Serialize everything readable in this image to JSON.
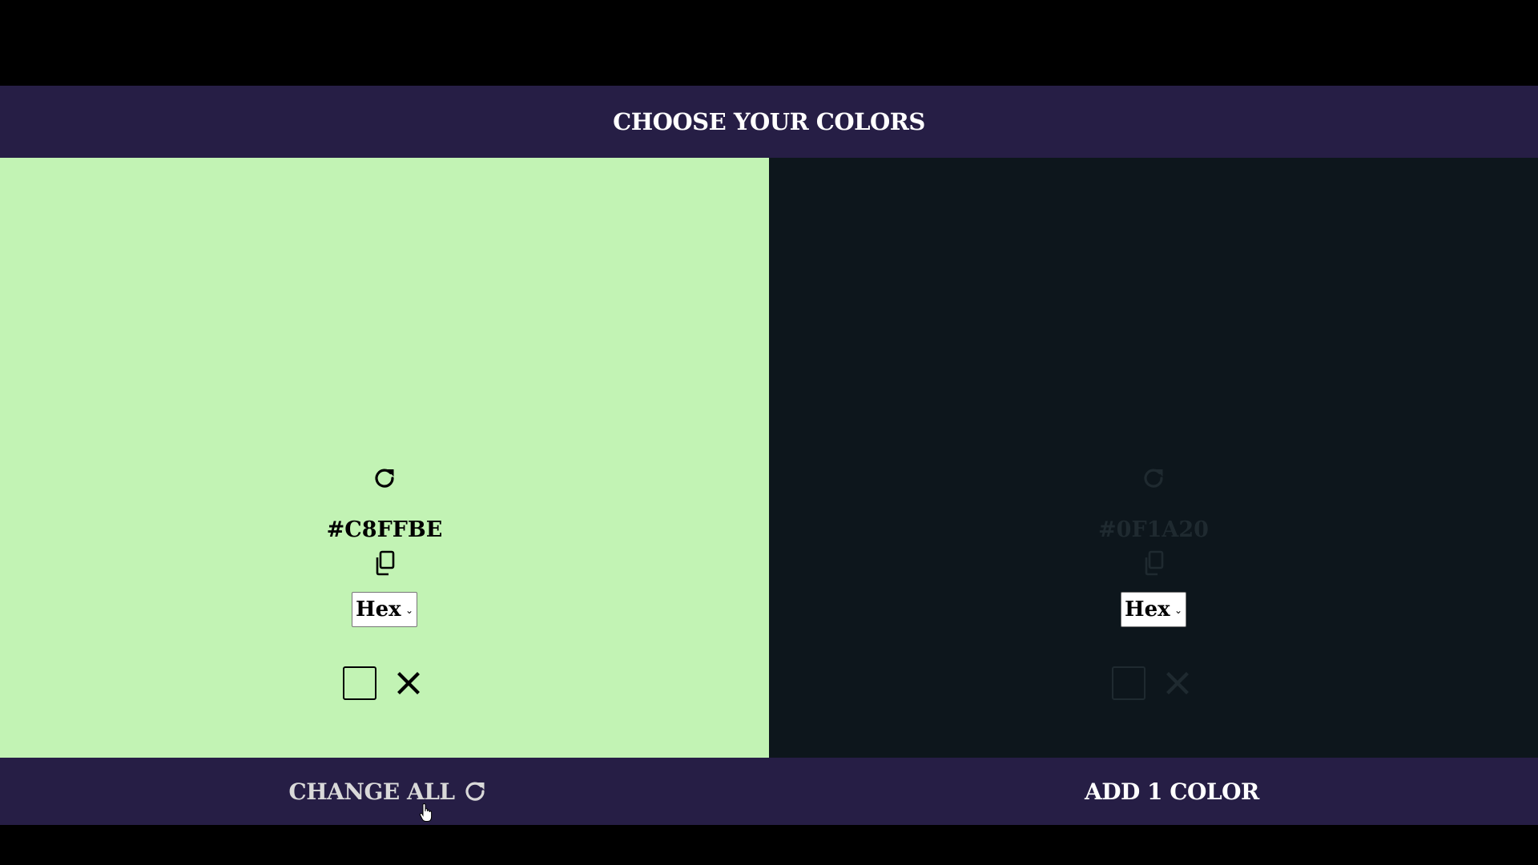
{
  "header": {
    "title": "CHOOSE YOUR COLORS"
  },
  "panels": [
    {
      "hex": "#C8FFBE",
      "background": "#c2f3b4",
      "foreground": "#000000",
      "format": "Hex",
      "refresh_icon": "refresh-icon",
      "copy_icon": "copy-icon",
      "remove_icon": "close-icon",
      "locked": false
    },
    {
      "hex": "#0F1A20",
      "background": "#0d161c",
      "foreground": "#1f2a30",
      "format": "Hex",
      "refresh_icon": "refresh-icon",
      "copy_icon": "copy-icon",
      "remove_icon": "close-icon",
      "locked": false
    }
  ],
  "footer": {
    "change_all_label": "CHANGE ALL",
    "change_all_icon": "refresh-icon",
    "add_color_label": "ADD 1 COLOR"
  },
  "colors": {
    "bar_background": "#261e45",
    "page_background": "#000000"
  }
}
